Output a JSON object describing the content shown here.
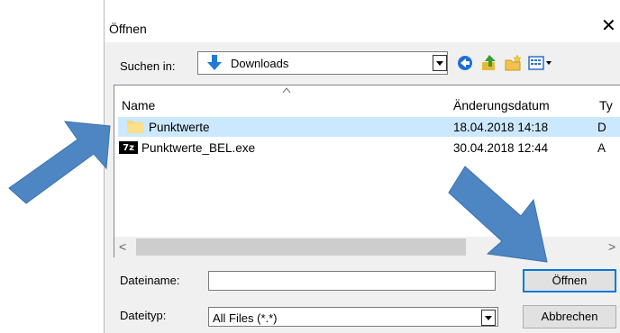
{
  "dialog": {
    "title": "Öffnen",
    "close_glyph": "✕"
  },
  "toolbar": {
    "lookin_label": "Suchen in:",
    "lookin_value": "Downloads",
    "icons": [
      "back-icon",
      "up-folder-icon",
      "new-folder-icon",
      "view-menu-icon"
    ]
  },
  "list": {
    "columns": {
      "name": "Name",
      "date": "Änderungsdatum",
      "type": "Ty"
    },
    "rows": [
      {
        "name": "Punktwerte",
        "date": "18.04.2018 14:18",
        "type": "D",
        "icon": "folder-icon",
        "selected": true
      },
      {
        "name": "Punktwerte_BEL.exe",
        "date": "30.04.2018 12:44",
        "type": "A",
        "icon": "7z-exe-icon",
        "icon_text": "7z",
        "selected": false
      }
    ],
    "scroll_left": "<",
    "scroll_right": ">"
  },
  "filename": {
    "label": "Dateiname:",
    "value": ""
  },
  "filetype": {
    "label": "Dateityp:",
    "value": "All Files (*.*)"
  },
  "buttons": {
    "open": "Öffnen",
    "cancel": "Abbrechen"
  },
  "colors": {
    "selection": "#cce8ff",
    "accent": "#0078d7",
    "annotation_arrow": "#4e86c3"
  }
}
